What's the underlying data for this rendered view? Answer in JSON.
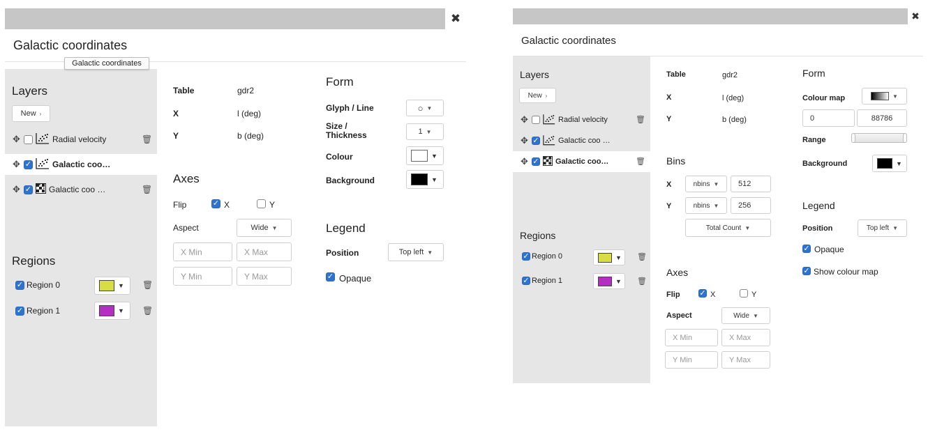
{
  "windowA": {
    "title": "Galactic coordinates",
    "tooltip": "Galactic coordinates",
    "close_icon": "close-icon",
    "layers_heading": "Layers",
    "new_button": "New",
    "layers": [
      {
        "label": "Radial velocity",
        "checked": false,
        "icon": "scatter-icon",
        "bold": false,
        "selected": false,
        "trash": true
      },
      {
        "label": "Galactic coo…",
        "checked": true,
        "icon": "scatter-icon",
        "bold": true,
        "selected": true,
        "trash": false
      },
      {
        "label": "Galactic coo …",
        "checked": true,
        "icon": "density-grid-icon",
        "bold": false,
        "selected": false,
        "trash": true
      }
    ],
    "regions_heading": "Regions",
    "regions": [
      {
        "label": "Region 0",
        "color": "#d9dd45"
      },
      {
        "label": "Region 1",
        "color": "#b52ec4"
      }
    ],
    "table_label": "Table",
    "table_value": "gdr2",
    "x_label": "X",
    "x_value": "l (deg)",
    "y_label": "Y",
    "y_value": "b (deg)",
    "axes_heading": "Axes",
    "flip_label": "Flip",
    "flip_x": "X",
    "flip_y": "Y",
    "aspect_label": "Aspect",
    "aspect_value": "Wide",
    "xmin_placeholder": "X Min",
    "xmax_placeholder": "X Max",
    "ymin_placeholder": "Y Min",
    "ymax_placeholder": "Y Max",
    "form_heading": "Form",
    "glyph_label": "Glyph / Line",
    "glyph_value": "○",
    "size_label_1": "Size /",
    "size_label_2": "Thickness",
    "size_value": "1",
    "colour_label": "Colour",
    "colour_color": "#ffffff",
    "background_label": "Background",
    "background_color": "#000000",
    "legend_heading": "Legend",
    "position_label": "Position",
    "position_value": "Top left",
    "opaque_label": "Opaque"
  },
  "windowB": {
    "title": "Galactic coordinates",
    "close_icon": "close-icon",
    "layers_heading": "Layers",
    "new_button": "New",
    "layers": [
      {
        "label": "Radial velocity",
        "checked": false,
        "icon": "scatter-icon",
        "bold": false,
        "selected": false,
        "trash": true
      },
      {
        "label": "Galactic coo …",
        "checked": true,
        "icon": "scatter-icon",
        "bold": false,
        "selected": false,
        "trash": false
      },
      {
        "label": "Galactic coo…",
        "checked": true,
        "icon": "density-grid-icon",
        "bold": true,
        "selected": true,
        "trash": true
      }
    ],
    "regions_heading": "Regions",
    "regions": [
      {
        "label": "Region 0",
        "color": "#d9dd45"
      },
      {
        "label": "Region 1",
        "color": "#b52ec4"
      }
    ],
    "table_label": "Table",
    "table_value": "gdr2",
    "x_label": "X",
    "x_value": "l (deg)",
    "y_label": "Y",
    "y_value": "b (deg)",
    "bins_heading": "Bins",
    "bins_x_label": "X",
    "bins_x_mode": "nbins",
    "bins_x_value": "512",
    "bins_y_label": "Y",
    "bins_y_mode": "nbins",
    "bins_y_value": "256",
    "aggregate_value": "Total Count",
    "axes_heading": "Axes",
    "flip_label": "Flip",
    "flip_x": "X",
    "flip_y": "Y",
    "aspect_label": "Aspect",
    "aspect_value": "Wide",
    "xmin_placeholder": "X Min",
    "xmax_placeholder": "X Max",
    "ymin_placeholder": "Y Min",
    "ymax_placeholder": "Y Max",
    "form_heading": "Form",
    "colourmap_label": "Colour map",
    "range_min": "0",
    "range_max": "88786",
    "range_label": "Range",
    "background_label": "Background",
    "background_color": "#000000",
    "legend_heading": "Legend",
    "position_label": "Position",
    "position_value": "Top left",
    "opaque_label": "Opaque",
    "show_colourmap_label": "Show colour map"
  }
}
